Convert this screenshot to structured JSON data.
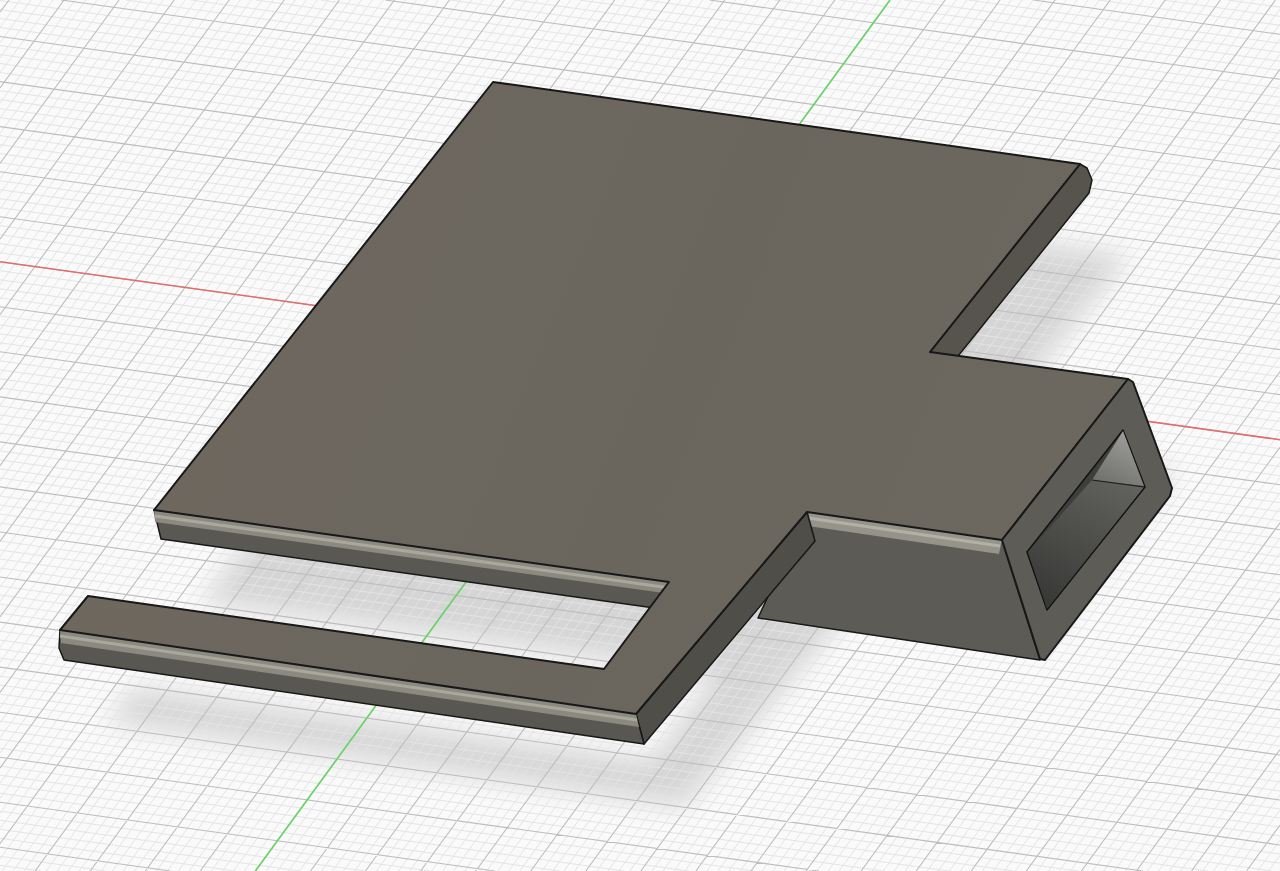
{
  "viewport": {
    "axes": [
      {
        "kind": "x",
        "color": "#e26d6d"
      },
      {
        "kind": "y",
        "color": "#66d466"
      }
    ]
  }
}
